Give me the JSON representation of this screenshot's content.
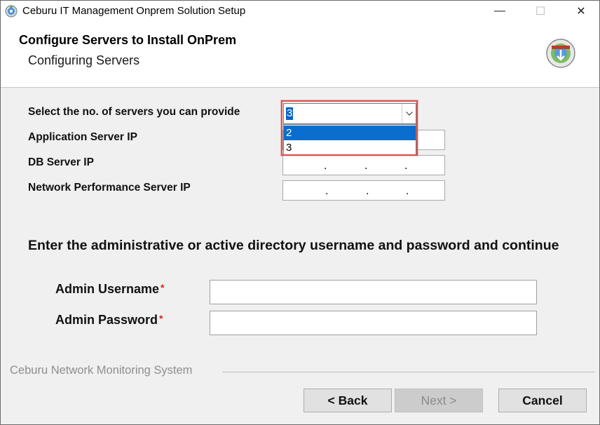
{
  "window": {
    "title": "Ceburu IT Management Onprem Solution Setup",
    "controls": {
      "minimize": "—",
      "maximize": "☐",
      "close": "✕"
    }
  },
  "header": {
    "title": "Configure Servers to Install OnPrem",
    "subtitle": "Configuring Servers",
    "logo_icon": "installer-disc-icon"
  },
  "servers": {
    "count_label": "Select the no. of servers you can provide",
    "count_selected": "3",
    "count_options": [
      "2",
      "3"
    ],
    "count_highlighted_option": "2",
    "fields": [
      {
        "label": "Application Server IP",
        "value": ". . ."
      },
      {
        "label": "DB Server IP",
        "value": ". . ."
      },
      {
        "label": "Network Performance Server IP",
        "value": ". . ."
      }
    ],
    "ip_separator": "."
  },
  "credentials": {
    "heading": "Enter the administrative or active directory username and password and continue",
    "username_label": "Admin Username",
    "password_label": "Admin Password",
    "required_mark": "*",
    "username_value": "",
    "password_value": ""
  },
  "footer": {
    "brand": "Ceburu Network Monitoring System",
    "back_label": "< Back",
    "next_label": "Next >",
    "cancel_label": "Cancel"
  },
  "colors": {
    "selection": "#0a64c8",
    "highlight_border": "#d9534f",
    "required": "#e0201b"
  }
}
